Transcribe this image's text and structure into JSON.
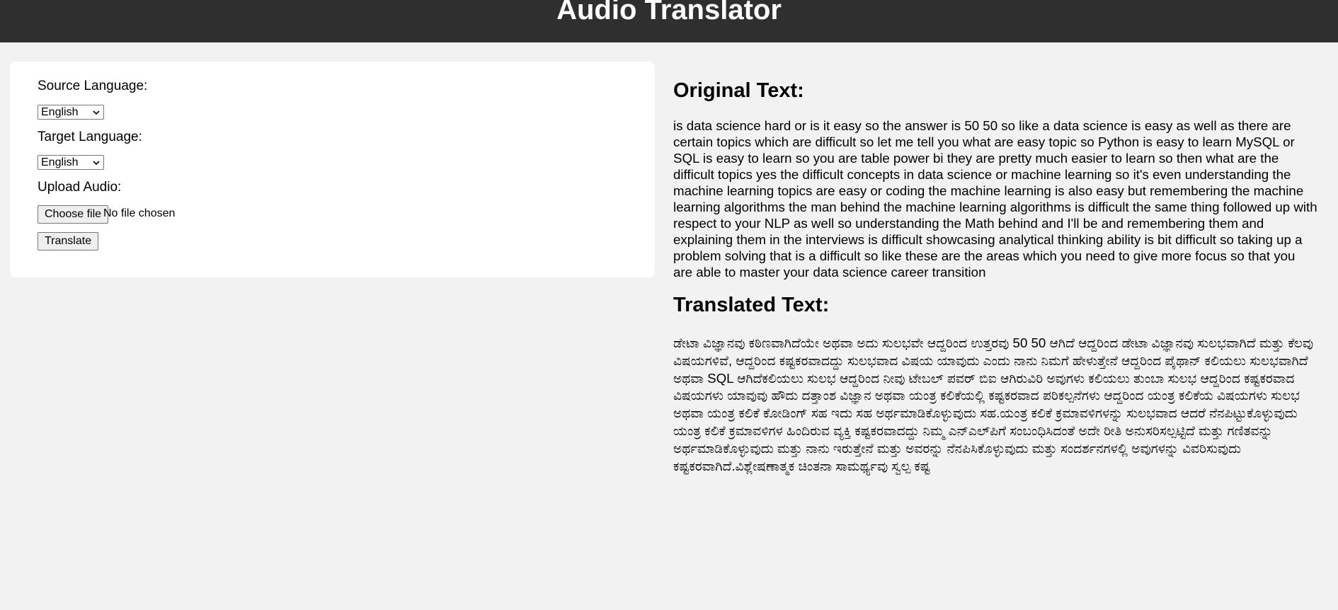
{
  "header": {
    "title": "Audio Translator"
  },
  "form": {
    "source_label": "Source Language:",
    "source_value": "English",
    "target_label": "Target Language:",
    "target_value": "English",
    "upload_label": "Upload Audio:",
    "choose_file_label": "Choose file",
    "file_status": "No file chosen",
    "translate_label": "Translate"
  },
  "results": {
    "original_heading": "Original Text:",
    "original_text": "is data science hard or is it easy so the answer is 50 50 so like a data science is easy as well as there are certain topics which are difficult so let me tell you what are easy topic so Python is easy to learn MySQL or SQL is easy to learn so you are table power bi they are pretty much easier to learn so then what are the difficult topics yes the difficult concepts in data science or machine learning so it's even understanding the machine learning topics are easy or coding the machine learning is also easy but remembering the machine learning algorithms the man behind the machine learning algorithms is difficult the same thing followed up with respect to your NLP as well so understanding the Math behind and I'll be and remembering them and explaining them in the interviews is difficult showcasing analytical thinking ability is bit difficult so taking up a problem solving that is a difficult so like these are the areas which you need to give more focus so that you are able to master your data science career transition",
    "translated_heading": "Translated Text:",
    "translated_text": "ಡೇಟಾ ವಿಜ್ಞಾನವು ಕಠಿಣವಾಗಿದೆಯೇ ಅಥವಾ ಅದು ಸುಲಭವೇ ಆದ್ದರಿಂದ ಉತ್ತರವು 50 50 ಆಗಿದೆ ಆದ್ದರಿಂದ ಡೇಟಾ ವಿಜ್ಞಾನವು ಸುಲಭವಾಗಿದೆ ಮತ್ತು ಕೆಲವು ವಿಷಯಗಳಿವೆ, ಆದ್ದರಿಂದ ಕಷ್ಟಕರವಾದದ್ದು ಸುಲಭವಾದ ವಿಷಯ ಯಾವುದು ಎಂದು ನಾನು ನಿಮಗೆ ಹೇಳುತ್ತೇನೆ ಆದ್ದರಿಂದ ಪೈಥಾನ್ ಕಲಿಯಲು ಸುಲಭವಾಗಿದೆ ಅಥವಾ SQL ಆಗಿದೆಕಲಿಯಲು ಸುಲಭ ಆದ್ದರಿಂದ ನೀವು ಟೇಬಲ್ ಪವರ್ ಬಿಐ ಆಗಿರುವಿರಿ ಅವುಗಳು ಕಲಿಯಲು ತುಂಬಾ ಸುಲಭ ಆದ್ದರಿಂದ ಕಷ್ಟಕರವಾದ ವಿಷಯಗಳು ಯಾವುವು ಹೌದು ದತ್ತಾಂಶ ವಿಜ್ಞಾನ ಅಥವಾ ಯಂತ್ರ ಕಲಿಕೆಯಲ್ಲಿ ಕಷ್ಟಕರವಾದ ಪರಿಕಲ್ಪನೆಗಳು ಆದ್ದರಿಂದ ಯಂತ್ರ ಕಲಿಕೆಯ ವಿಷಯಗಳು ಸುಲಭ ಅಥವಾ ಯಂತ್ರ ಕಲಿಕೆ ಕೋಡಿಂಗ್ ಸಹ ಇದು ಸಹ ಅರ್ಥಮಾಡಿಕೊಳ್ಳುವುದು ಸಹ.ಯಂತ್ರ ಕಲಿಕೆ ಕ್ರಮಾವಳಿಗಳನ್ನು ಸುಲಭವಾದ ಆದರೆ ನೆನಪಿಟ್ಟುಕೊಳ್ಳುವುದು ಯಂತ್ರ ಕಲಿಕೆ ಕ್ರಮಾವಳಿಗಳ ಹಿಂದಿರುವ ವ್ಯಕ್ತಿ ಕಷ್ಟಕರವಾದದ್ದು ನಿಮ್ಮ ಎನ್‌ಎಲ್‌ಪಿಗೆ ಸಂಬಂಧಿಸಿದಂತೆ ಅದೇ ರೀತಿ ಅನುಸರಿಸಲ್ಪಟ್ಟಿದೆ ಮತ್ತು ಗಣಿತವನ್ನು ಅರ್ಥಮಾಡಿಕೊಳ್ಳುವುದು ಮತ್ತು ನಾನು ಇರುತ್ತೇನೆ ಮತ್ತು ಅವರನ್ನು ನೆನಪಿಸಿಕೊಳ್ಳುವುದು ಮತ್ತು ಸಂದರ್ಶನಗಳಲ್ಲಿ ಅವುಗಳನ್ನು ವಿವರಿಸುವುದು ಕಷ್ಟಕರವಾಗಿದೆ.ವಿಶ್ಲೇಷಣಾತ್ಮಕ ಚಿಂತನಾ ಸಾಮರ್ಥ್ಯವು ಸ್ವಲ್ಪ ಕಷ್ಟ"
  },
  "icons": {
    "select_chevron": "chevron-down-icon"
  }
}
